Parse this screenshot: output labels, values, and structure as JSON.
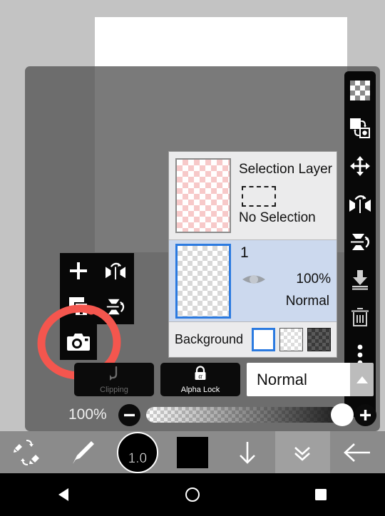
{
  "app": {
    "canvas": {
      "name": "drawing-canvas",
      "background_color": "#ffffff"
    },
    "workspace_color": "#c3c3c3",
    "panel_color": "#555555",
    "accent_color": "#2b7ae0",
    "annotation_color": "#f4564e"
  },
  "right_toolbar": {
    "items": [
      {
        "icon": "transparency-checker-icon",
        "label": "Transparency"
      },
      {
        "icon": "swap-layers-icon",
        "label": "Swap Layers"
      },
      {
        "icon": "move-layer-icon",
        "label": "Move Layer"
      },
      {
        "icon": "flip-horizontal-icon",
        "label": "Flip Horizontal"
      },
      {
        "icon": "flip-vertical-icon",
        "label": "Flip Vertical"
      },
      {
        "icon": "merge-down-icon",
        "label": "Merge Down"
      },
      {
        "icon": "delete-layer-icon",
        "label": "Delete Layer"
      },
      {
        "icon": "more-options-icon",
        "label": "More"
      }
    ]
  },
  "left_grid_toolbar": {
    "items": [
      {
        "icon": "add-layer-icon",
        "label": "Add Layer"
      },
      {
        "icon": "flip-horizontal-icon",
        "label": "Flip Horizontal"
      },
      {
        "icon": "duplicate-layer-icon",
        "label": "Duplicate Layer"
      },
      {
        "icon": "flip-vertical-icon",
        "label": "Flip Vertical"
      }
    ],
    "camera": {
      "icon": "camera-icon",
      "label": "Import Photo"
    }
  },
  "layer_list": {
    "rows": [
      {
        "type": "selection",
        "thumbnail": "pink-checker-thumbnail",
        "title": "Selection Layer",
        "marquee_icon": "selection-marquee-icon",
        "status": "No Selection",
        "selected": false
      },
      {
        "type": "layer",
        "thumbnail": "transparent-checker-thumbnail",
        "name": "1",
        "visibility_icon": "eye-icon",
        "opacity": "100%",
        "blend_mode": "Normal",
        "selected": true
      }
    ],
    "background": {
      "label": "Background",
      "swatches": [
        {
          "name": "white-swatch",
          "selected": true
        },
        {
          "name": "light-checker-swatch",
          "selected": false
        },
        {
          "name": "dark-checker-swatch",
          "selected": false
        }
      ]
    }
  },
  "options_row": {
    "clipping": {
      "label": "Clipping",
      "icon": "clipping-arrow-icon",
      "enabled": false
    },
    "alpha_lock": {
      "label": "Alpha Lock",
      "icon": "alpha-lock-icon",
      "enabled": true
    },
    "blend_mode": {
      "value": "Normal",
      "caret_icon": "caret-up-icon"
    }
  },
  "opacity": {
    "value": "100%",
    "minus_label": "−",
    "plus_label": "+"
  },
  "bottom_toolbar": {
    "items": [
      {
        "icon": "brush-eraser-swap-icon",
        "label": "Swap Tool"
      },
      {
        "icon": "brush-icon",
        "label": "Brush"
      },
      {
        "icon": "brush-size-icon",
        "label": "Brush Size",
        "value": "1.0"
      },
      {
        "icon": "color-swatch-icon",
        "label": "Color",
        "color": "#000000"
      },
      {
        "icon": "arrow-down-icon",
        "label": "Down"
      },
      {
        "icon": "double-chevron-down-icon",
        "label": "Collapse Panel"
      },
      {
        "icon": "back-arrow-icon",
        "label": "Back"
      }
    ]
  },
  "nav_bar": {
    "items": [
      {
        "icon": "android-back-icon",
        "label": "Back"
      },
      {
        "icon": "android-home-icon",
        "label": "Home"
      },
      {
        "icon": "android-recents-icon",
        "label": "Recents"
      }
    ]
  }
}
